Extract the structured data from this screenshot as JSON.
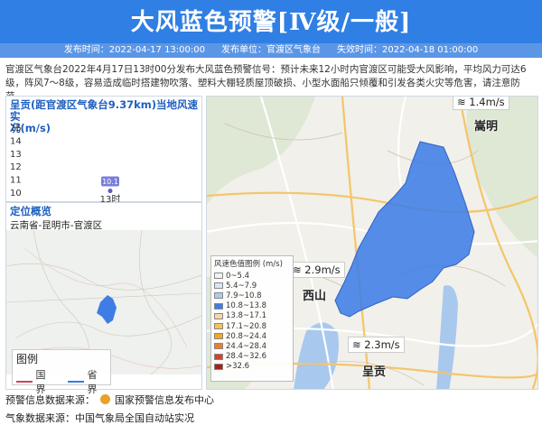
{
  "header": {
    "title": "大风蓝色预警[Ⅳ级/一般]",
    "publish_time": "发布时间：2022-04-17 13:00:00",
    "publisher": "发布单位：官渡区气象台",
    "expire_time": "失效时间：2022-04-18 01:00:00"
  },
  "description": "官渡区气象台2022年4月17日13时00分发布大风蓝色预警信号：预计未来12小时内官渡区可能受大风影响，平均风力可达6级，阵风7～8级，容易造成临时搭建物吹落、塑料大棚轻质屋顶破损、小型水面船只倾覆和引发各类火灾等危害，请注意防范。",
  "wind_chart": {
    "title_line1": "呈贡(距官渡区气象台9.37km)当地风速实",
    "title_line2": "况(m/s)",
    "chart_data": {
      "type": "line",
      "categories": [
        "13时"
      ],
      "values": [
        10.1
      ],
      "value_label": "10.1",
      "ylim": [
        10,
        15
      ],
      "yticks": [
        "15",
        "14",
        "13",
        "12",
        "11",
        "10"
      ]
    }
  },
  "location": {
    "title": "定位概览",
    "region": "云南省-昆明市-官渡区",
    "legend_title": "图例",
    "legend_national": "国界",
    "legend_provincial": "省界"
  },
  "map": {
    "legend_title": "风速色值图例 (m/s)",
    "legend_items": [
      {
        "label": "0~5.4",
        "color": "#f2f2f2"
      },
      {
        "label": "5.4~7.9",
        "color": "#d6e6f7"
      },
      {
        "label": "7.9~10.8",
        "color": "#a9cdf2"
      },
      {
        "label": "10.8~13.8",
        "color": "#3f7de6"
      },
      {
        "label": "13.8~17.1",
        "color": "#f7d7a8"
      },
      {
        "label": "17.1~20.8",
        "color": "#f7c25a"
      },
      {
        "label": "20.8~24.4",
        "color": "#f5a623"
      },
      {
        "label": "24.4~28.4",
        "color": "#ef7d2b"
      },
      {
        "label": "28.4~32.6",
        "color": "#d9402a"
      },
      {
        "label": ">32.6",
        "color": "#a8201a"
      }
    ],
    "wind_labels": [
      "1.4m/s",
      "2.9m/s",
      "2.3m/s"
    ],
    "cities": [
      "嵩明",
      "西山",
      "呈贡"
    ],
    "wind_icon": "wind-icon"
  },
  "footer": {
    "source1": "预警信息数据来源：",
    "source1_org": "国家预警信息发布中心",
    "source2": "气象数据来源：中国气象局全国自动站实况"
  },
  "colors": {
    "header_bg": "#2f7fe4",
    "warning_blue": "#3f7de6",
    "title_blue": "#1f5fbf"
  }
}
